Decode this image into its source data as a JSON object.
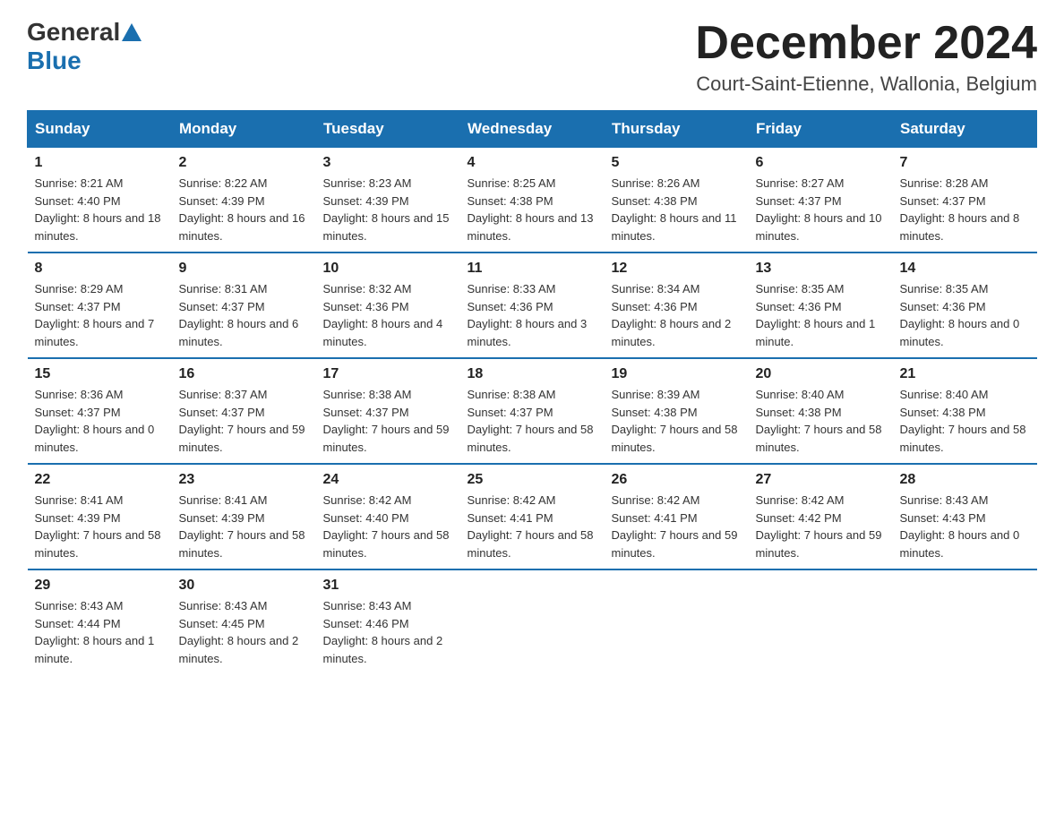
{
  "logo": {
    "general": "General",
    "blue": "Blue",
    "triangle_color": "#1a6faf"
  },
  "title": {
    "month": "December 2024",
    "location": "Court-Saint-Etienne, Wallonia, Belgium"
  },
  "days_of_week": [
    "Sunday",
    "Monday",
    "Tuesday",
    "Wednesday",
    "Thursday",
    "Friday",
    "Saturday"
  ],
  "weeks": [
    [
      {
        "num": "1",
        "sunrise": "8:21 AM",
        "sunset": "4:40 PM",
        "daylight": "8 hours and 18 minutes."
      },
      {
        "num": "2",
        "sunrise": "8:22 AM",
        "sunset": "4:39 PM",
        "daylight": "8 hours and 16 minutes."
      },
      {
        "num": "3",
        "sunrise": "8:23 AM",
        "sunset": "4:39 PM",
        "daylight": "8 hours and 15 minutes."
      },
      {
        "num": "4",
        "sunrise": "8:25 AM",
        "sunset": "4:38 PM",
        "daylight": "8 hours and 13 minutes."
      },
      {
        "num": "5",
        "sunrise": "8:26 AM",
        "sunset": "4:38 PM",
        "daylight": "8 hours and 11 minutes."
      },
      {
        "num": "6",
        "sunrise": "8:27 AM",
        "sunset": "4:37 PM",
        "daylight": "8 hours and 10 minutes."
      },
      {
        "num": "7",
        "sunrise": "8:28 AM",
        "sunset": "4:37 PM",
        "daylight": "8 hours and 8 minutes."
      }
    ],
    [
      {
        "num": "8",
        "sunrise": "8:29 AM",
        "sunset": "4:37 PM",
        "daylight": "8 hours and 7 minutes."
      },
      {
        "num": "9",
        "sunrise": "8:31 AM",
        "sunset": "4:37 PM",
        "daylight": "8 hours and 6 minutes."
      },
      {
        "num": "10",
        "sunrise": "8:32 AM",
        "sunset": "4:36 PM",
        "daylight": "8 hours and 4 minutes."
      },
      {
        "num": "11",
        "sunrise": "8:33 AM",
        "sunset": "4:36 PM",
        "daylight": "8 hours and 3 minutes."
      },
      {
        "num": "12",
        "sunrise": "8:34 AM",
        "sunset": "4:36 PM",
        "daylight": "8 hours and 2 minutes."
      },
      {
        "num": "13",
        "sunrise": "8:35 AM",
        "sunset": "4:36 PM",
        "daylight": "8 hours and 1 minute."
      },
      {
        "num": "14",
        "sunrise": "8:35 AM",
        "sunset": "4:36 PM",
        "daylight": "8 hours and 0 minutes."
      }
    ],
    [
      {
        "num": "15",
        "sunrise": "8:36 AM",
        "sunset": "4:37 PM",
        "daylight": "8 hours and 0 minutes."
      },
      {
        "num": "16",
        "sunrise": "8:37 AM",
        "sunset": "4:37 PM",
        "daylight": "7 hours and 59 minutes."
      },
      {
        "num": "17",
        "sunrise": "8:38 AM",
        "sunset": "4:37 PM",
        "daylight": "7 hours and 59 minutes."
      },
      {
        "num": "18",
        "sunrise": "8:38 AM",
        "sunset": "4:37 PM",
        "daylight": "7 hours and 58 minutes."
      },
      {
        "num": "19",
        "sunrise": "8:39 AM",
        "sunset": "4:38 PM",
        "daylight": "7 hours and 58 minutes."
      },
      {
        "num": "20",
        "sunrise": "8:40 AM",
        "sunset": "4:38 PM",
        "daylight": "7 hours and 58 minutes."
      },
      {
        "num": "21",
        "sunrise": "8:40 AM",
        "sunset": "4:38 PM",
        "daylight": "7 hours and 58 minutes."
      }
    ],
    [
      {
        "num": "22",
        "sunrise": "8:41 AM",
        "sunset": "4:39 PM",
        "daylight": "7 hours and 58 minutes."
      },
      {
        "num": "23",
        "sunrise": "8:41 AM",
        "sunset": "4:39 PM",
        "daylight": "7 hours and 58 minutes."
      },
      {
        "num": "24",
        "sunrise": "8:42 AM",
        "sunset": "4:40 PM",
        "daylight": "7 hours and 58 minutes."
      },
      {
        "num": "25",
        "sunrise": "8:42 AM",
        "sunset": "4:41 PM",
        "daylight": "7 hours and 58 minutes."
      },
      {
        "num": "26",
        "sunrise": "8:42 AM",
        "sunset": "4:41 PM",
        "daylight": "7 hours and 59 minutes."
      },
      {
        "num": "27",
        "sunrise": "8:42 AM",
        "sunset": "4:42 PM",
        "daylight": "7 hours and 59 minutes."
      },
      {
        "num": "28",
        "sunrise": "8:43 AM",
        "sunset": "4:43 PM",
        "daylight": "8 hours and 0 minutes."
      }
    ],
    [
      {
        "num": "29",
        "sunrise": "8:43 AM",
        "sunset": "4:44 PM",
        "daylight": "8 hours and 1 minute."
      },
      {
        "num": "30",
        "sunrise": "8:43 AM",
        "sunset": "4:45 PM",
        "daylight": "8 hours and 2 minutes."
      },
      {
        "num": "31",
        "sunrise": "8:43 AM",
        "sunset": "4:46 PM",
        "daylight": "8 hours and 2 minutes."
      },
      null,
      null,
      null,
      null
    ]
  ]
}
